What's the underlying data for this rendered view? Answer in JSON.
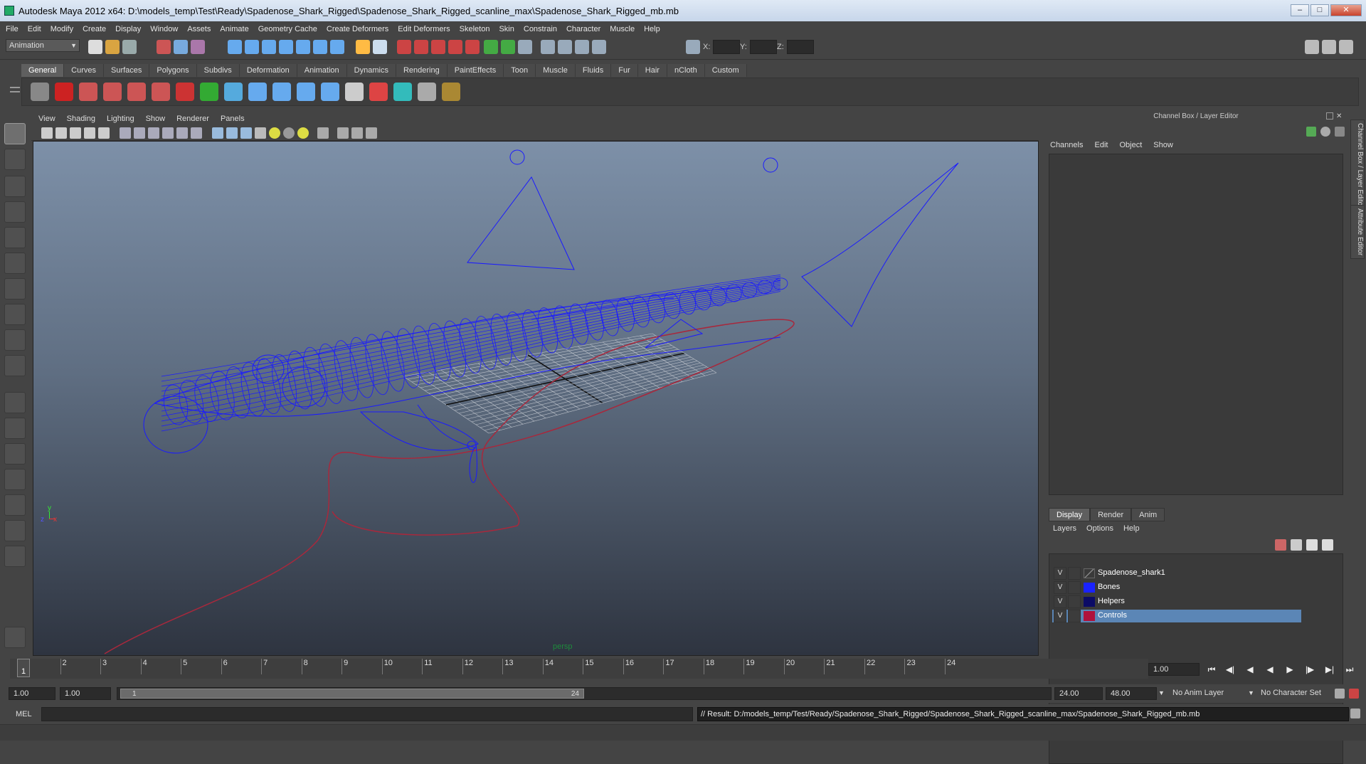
{
  "window": {
    "title": "Autodesk Maya 2012 x64: D:\\models_temp\\Test\\Ready\\Spadenose_Shark_Rigged\\Spadenose_Shark_Rigged_scanline_max\\Spadenose_Shark_Rigged_mb.mb"
  },
  "menu": [
    "File",
    "Edit",
    "Modify",
    "Create",
    "Display",
    "Window",
    "Assets",
    "Animate",
    "Geometry Cache",
    "Create Deformers",
    "Edit Deformers",
    "Skeleton",
    "Skin",
    "Constrain",
    "Character",
    "Muscle",
    "Help"
  ],
  "status_line": {
    "mode": "Animation",
    "x_label": "X:",
    "y_label": "Y:",
    "z_label": "Z:"
  },
  "shelf_tabs": [
    "General",
    "Curves",
    "Surfaces",
    "Polygons",
    "Subdivs",
    "Deformation",
    "Animation",
    "Dynamics",
    "Rendering",
    "PaintEffects",
    "Toon",
    "Muscle",
    "Fluids",
    "Fur",
    "Hair",
    "nCloth",
    "Custom"
  ],
  "viewport": {
    "menu": [
      "View",
      "Shading",
      "Lighting",
      "Show",
      "Renderer",
      "Panels"
    ],
    "camera_label": "persp",
    "axis_y": "y",
    "axis_x": "x",
    "axis_z": "z",
    "colors": {
      "wire": "#1a1aff",
      "curve": "#a8283c",
      "grid": "#bfc4cc",
      "grid_axis": "#111111"
    }
  },
  "channel_box": {
    "title": "Channel Box / Layer Editor",
    "menu": [
      "Channels",
      "Edit",
      "Object",
      "Show"
    ]
  },
  "layer_editor": {
    "tabs": [
      "Display",
      "Render",
      "Anim"
    ],
    "menu": [
      "Layers",
      "Options",
      "Help"
    ],
    "layers": [
      {
        "visible": "V",
        "name": "Spadenose_shark1",
        "color": ""
      },
      {
        "visible": "V",
        "name": "Bones",
        "color": "#1a22ff"
      },
      {
        "visible": "V",
        "name": "Helpers",
        "color": "#0b0b66"
      },
      {
        "visible": "V",
        "name": "Controls",
        "color": "#b0123c"
      }
    ]
  },
  "side_tabs": [
    "Channel Box / Layer Editor",
    "Attribute Editor"
  ],
  "time_slider": {
    "ticks": [
      "1",
      "2",
      "3",
      "4",
      "5",
      "6",
      "7",
      "8",
      "9",
      "10",
      "11",
      "12",
      "13",
      "14",
      "15",
      "16",
      "17",
      "18",
      "19",
      "20",
      "21",
      "22",
      "23",
      "24"
    ],
    "current_frame_marker": "1",
    "current_frame": "1.00"
  },
  "range_slider": {
    "start": "1.00",
    "playback_start": "1.00",
    "range_start_label": "1",
    "range_end_label": "24",
    "playback_end": "24.00",
    "end": "48.00",
    "anim_layer": "No Anim Layer",
    "character_set": "No Character Set"
  },
  "command_line": {
    "language": "MEL",
    "result": "// Result: D:/models_temp/Test/Ready/Spadenose_Shark_Rigged/Spadenose_Shark_Rigged_scanline_max/Spadenose_Shark_Rigged_mb.mb"
  }
}
